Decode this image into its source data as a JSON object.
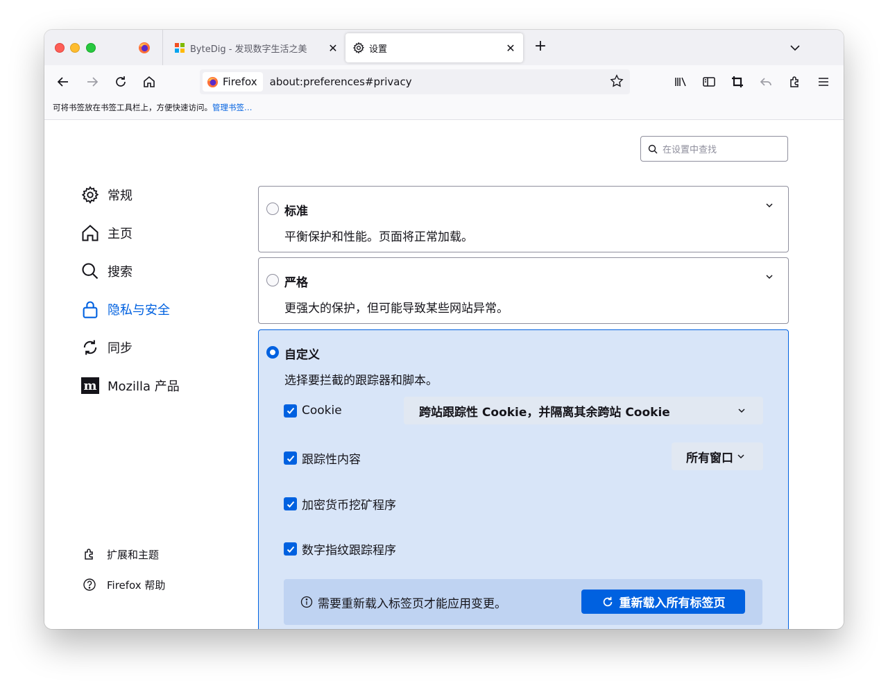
{
  "tabs": [
    {
      "title": "ByteDig - 发现数字生活之美",
      "icon": "bytedig-logo-icon"
    },
    {
      "title": "设置",
      "icon": "gear-icon"
    }
  ],
  "urlbar": {
    "identity_label": "Firefox",
    "url": "about:preferences#privacy"
  },
  "bookmarks_bar": {
    "message": "可将书签放在书签工具栏上，方便快速访问。",
    "link": "管理书签…"
  },
  "search": {
    "placeholder": "在设置中查找"
  },
  "sidebar": {
    "items": [
      {
        "label": "常规",
        "icon": "gear-icon"
      },
      {
        "label": "主页",
        "icon": "home-icon"
      },
      {
        "label": "搜索",
        "icon": "search-icon"
      },
      {
        "label": "隐私与安全",
        "icon": "lock-icon",
        "active": true
      },
      {
        "label": "同步",
        "icon": "sync-icon"
      },
      {
        "label": "Mozilla 产品",
        "icon": "mozilla-logo-icon"
      }
    ],
    "footer": [
      {
        "label": "扩展和主题",
        "icon": "puzzle-icon"
      },
      {
        "label": "Firefox 帮助",
        "icon": "help-icon"
      }
    ]
  },
  "protection": {
    "standard": {
      "title": "标准",
      "desc": "平衡保护和性能。页面将正常加载。"
    },
    "strict": {
      "title": "严格",
      "desc": "更强大的保护，但可能导致某些网站异常。"
    },
    "custom": {
      "title": "自定义",
      "desc": "选择要拦截的跟踪器和脚本。",
      "options": [
        {
          "label": "Cookie",
          "checked": true,
          "select": "跨站跟踪性 Cookie，并隔离其余跨站 Cookie"
        },
        {
          "label": "跟踪性内容",
          "checked": true,
          "select": "所有窗口"
        },
        {
          "label": "加密货币挖矿程序",
          "checked": true
        },
        {
          "label": "数字指纹跟踪程序",
          "checked": true
        }
      ],
      "notice": "需要重新载入标签页才能应用变更。",
      "reload_button": "重新载入所有标签页"
    }
  },
  "colors": {
    "accent": "#0061e0",
    "selected_card_bg": "#d8e5f8",
    "notice_bg": "#bfd3f2"
  }
}
